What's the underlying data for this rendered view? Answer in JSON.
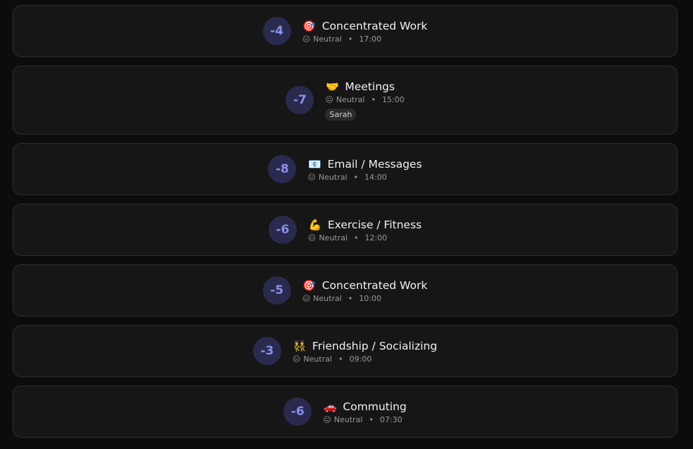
{
  "entries": [
    {
      "score": "-4",
      "emoji": "🎯",
      "icon": "target-icon",
      "title": "Concentrated Work",
      "mood_emoji": "😐",
      "mood": "Neutral",
      "sep": "•",
      "time": "17:00"
    },
    {
      "score": "-7",
      "emoji": "🤝",
      "icon": "handshake-icon",
      "title": "Meetings",
      "mood_emoji": "😐",
      "mood": "Neutral",
      "sep": "•",
      "time": "15:00",
      "tag": "Sarah"
    },
    {
      "score": "-8",
      "emoji": "📧",
      "icon": "email-icon",
      "title": "Email / Messages",
      "mood_emoji": "😐",
      "mood": "Neutral",
      "sep": "•",
      "time": "14:00"
    },
    {
      "score": "-6",
      "emoji": "💪",
      "icon": "flexed-biceps-icon",
      "title": "Exercise / Fitness",
      "mood_emoji": "😐",
      "mood": "Neutral",
      "sep": "•",
      "time": "12:00"
    },
    {
      "score": "-5",
      "emoji": "🎯",
      "icon": "target-icon",
      "title": "Concentrated Work",
      "mood_emoji": "😐",
      "mood": "Neutral",
      "sep": "•",
      "time": "10:00"
    },
    {
      "score": "-3",
      "emoji": "👯",
      "icon": "people-dancing-icon",
      "title": "Friendship / Socializing",
      "mood_emoji": "😐",
      "mood": "Neutral",
      "sep": "•",
      "time": "09:00"
    },
    {
      "score": "-6",
      "emoji": "🚗",
      "icon": "car-icon",
      "title": "Commuting",
      "mood_emoji": "😐",
      "mood": "Neutral",
      "sep": "•",
      "time": "07:30"
    }
  ]
}
